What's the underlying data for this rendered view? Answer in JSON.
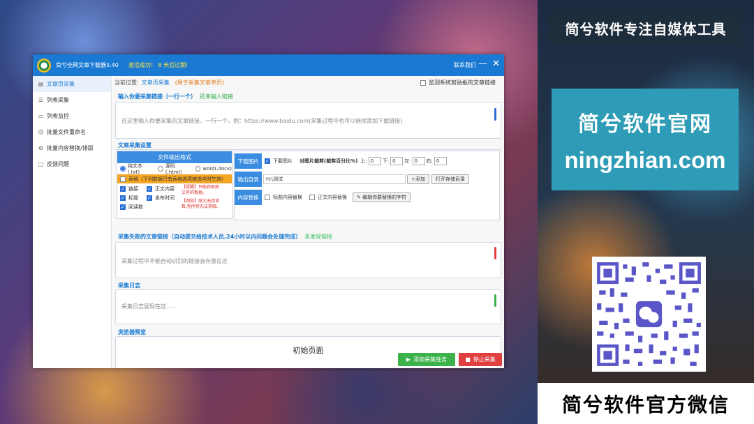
{
  "promo": {
    "top_banner": "简兮软件专注自媒体工具",
    "site_line1": "简兮软件官网",
    "site_line2": "ningzhian.com",
    "bottom_banner": "简兮软件官方微信"
  },
  "window": {
    "title": "简兮全网文章下载器3.40",
    "status": "激活成功！ 8 天后过期!",
    "contact": "联系我们",
    "minimize": "—",
    "close": "✕"
  },
  "sidebar": {
    "items": [
      {
        "label": "文章页采集",
        "icon": "document-icon"
      },
      {
        "label": "列表采集",
        "icon": "list-icon"
      },
      {
        "label": "列表监控",
        "icon": "monitor-icon"
      },
      {
        "label": "批量文件重命名",
        "icon": "rename-icon"
      },
      {
        "label": "批量内容替换/排版",
        "icon": "replace-icon"
      },
      {
        "label": "反馈问题",
        "icon": "feedback-icon"
      }
    ]
  },
  "breadcrumb": {
    "prefix": "当前位置:",
    "value": "文章页采集",
    "note": "(用于采集文章单页)"
  },
  "monitor_clipboard": "监测系统剪贴板的文章链接",
  "input_section": {
    "label": "输入你要采集链接（一行一个）",
    "hint": "还未输入链接",
    "placeholder": "在这里输入你要采集的文章链接，一行一个，例：https://www.baidu.com(采集过程中也可以继续添加下载链接)"
  },
  "settings": {
    "label": "文章采集设置",
    "format_header": "文件输出格式",
    "formats": [
      "纯文本(.txt)",
      "源码(.html)",
      "word(.docx)"
    ],
    "table_option": "表格（下列数据只有表格选项被选中时生效）",
    "options": [
      "链接",
      "正文内容",
      "标题",
      "发布时间",
      "阅读数"
    ],
    "warning1": "【提醒】只能获取原文有的数据。",
    "warning2": "【例如】原文无阅读数,程序将无法获取。",
    "download_images_label": "下载图片",
    "download_images_check": "下载图片",
    "crop_label": "对图片裁剪(裁剪百分比%)",
    "crop_sides": [
      "上:",
      "下:",
      "左:",
      "右:"
    ],
    "crop_values": [
      "0",
      "0",
      "0",
      "0"
    ],
    "output_dir_label": "输出目录",
    "output_dir": "H:\\测试",
    "add_button": "+添加",
    "open_dir_button": "打开存储目录",
    "replace_label": "内容替换",
    "title_replace": "标题内容替换",
    "body_replace": "正文内容替换",
    "edit_replace": "编辑你要替换的字符"
  },
  "failed_section": {
    "label": "采集失败的文章链接（自动提交给技术人员,24小时以内问题会处理完成）",
    "hint": "未发现链接",
    "placeholder": "采集过程中不能自动识别的链接会存放在这"
  },
  "log_section": {
    "label": "采集日志",
    "placeholder": "采集日志展现在这......"
  },
  "preview_section": {
    "label": "浏览器预览",
    "title": "初始页面"
  },
  "actions": {
    "start": "添加采集任务",
    "stop": "停止采集"
  },
  "colors": {
    "titlebar": "#1a7ad3",
    "start_button": "#3cb34a",
    "stop_button": "#e04040"
  }
}
